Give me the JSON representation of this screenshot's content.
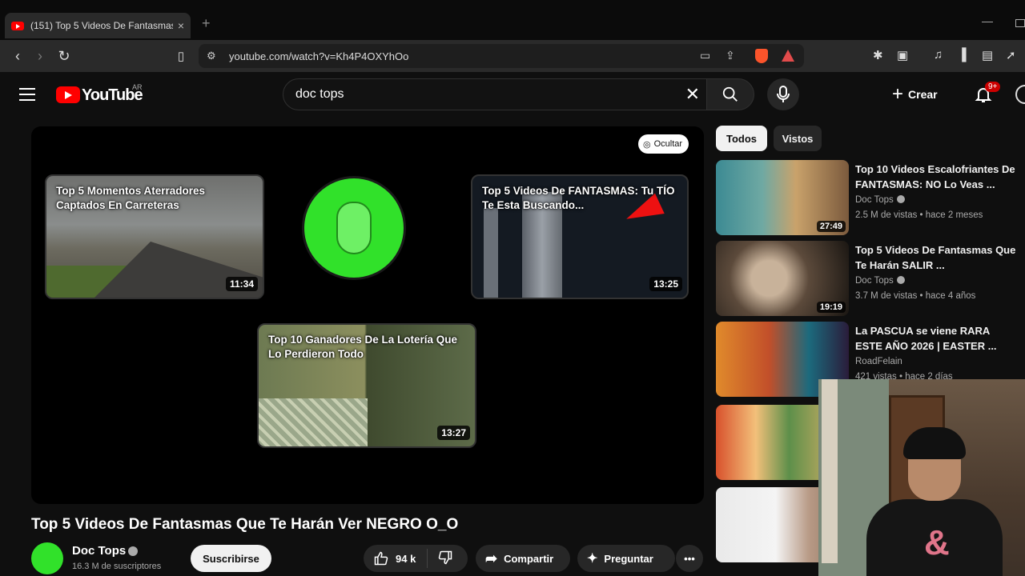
{
  "browser": {
    "tab_title": "(151) Top 5 Videos De Fantasmas",
    "new_tab": "+",
    "url": "youtube.com/watch?v=Kh4P4OXYhOo"
  },
  "header": {
    "logo_text": "YouTube",
    "country": "AR",
    "search_query": "doc tops",
    "create_label": "Crear",
    "notifications_badge": "9+"
  },
  "player": {
    "hide_label": "Ocultar",
    "endcards": [
      {
        "title": "Top 5 Momentos Aterradores Captados En Carreteras",
        "duration": "11:34"
      },
      {
        "title": "Top 5 Videos De FANTASMAS: Tu TÍO Te Esta Buscando...",
        "duration": "13:25"
      },
      {
        "title": "Top 10 Ganadores De La Lotería Que Lo Perdieron Todo",
        "duration": "13:27"
      }
    ]
  },
  "video": {
    "title": "Top 5 Videos De Fantasmas Que Te Harán Ver NEGRO O_O",
    "channel": "Doc Tops",
    "subscribers": "16.3 M de suscriptores",
    "subscribe_label": "Suscribirse",
    "likes": "94 k",
    "share_label": "Compartir",
    "ask_label": "Preguntar"
  },
  "sidebar": {
    "chips": [
      "Todos",
      "Vistos"
    ],
    "recs": [
      {
        "title": "Top 10 Videos Escalofriantes De FANTASMAS: NO Lo Veas ...",
        "channel": "Doc Tops",
        "meta": "2.5 M de vistas • hace 2 meses",
        "duration": "27:49"
      },
      {
        "title": "Top 5 Videos De Fantasmas Que Te Harán SALIR ...",
        "channel": "Doc Tops",
        "meta": "3.7 M de vistas • hace 4 años",
        "duration": "19:19"
      },
      {
        "title": "La PASCUA se viene RARA ESTE AÑO 2026 | EASTER ...",
        "channel": "RoadFelain",
        "meta": "421 vistas • hace 2 días",
        "duration": ""
      }
    ]
  },
  "colors": {
    "background": "#0f0f0f",
    "brand_red": "#ff0000",
    "channel_green": "#31e12a"
  }
}
